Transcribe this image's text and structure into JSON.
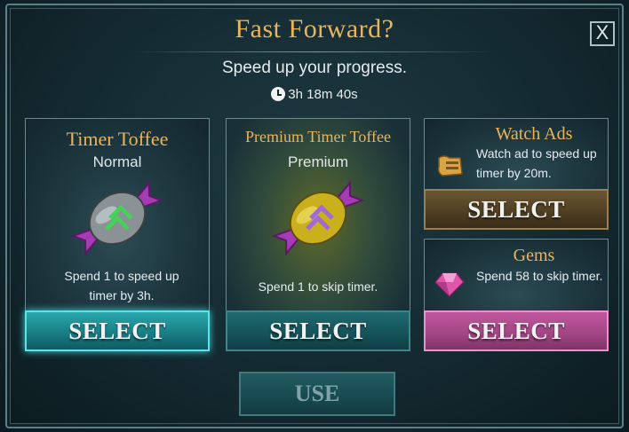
{
  "dialog": {
    "title": "Fast Forward?",
    "subtitle": "Speed up your progress.",
    "timer_text": "3h 18m 40s",
    "close_label": "X"
  },
  "options": {
    "timer_toffee": {
      "title": "Timer Toffee",
      "subtitle": "Normal",
      "description": "Spend 1 to speed up timer by 3h.",
      "button": "SELECT"
    },
    "premium_toffee": {
      "title": "Premium Timer Toffee",
      "subtitle": "Premium",
      "description": "Spend 1 to skip timer.",
      "button": "SELECT"
    },
    "watch_ads": {
      "title": "Watch Ads",
      "description": "Watch ad to speed up timer by 20m.",
      "button": "SELECT"
    },
    "gems": {
      "title": "Gems",
      "description": "Spend 58 to skip timer.",
      "button": "SELECT"
    }
  },
  "footer": {
    "use_label": "USE"
  },
  "colors": {
    "accent_gold": "#e8b45d",
    "selected_teal": "#5fe2e6",
    "gems_pink": "#c0579e",
    "ads_brown": "#6a5530"
  },
  "icons": [
    "close-icon",
    "clock-icon",
    "timer-toffee-candy-icon",
    "premium-toffee-candy-icon",
    "film-scroll-icon",
    "gem-icon"
  ]
}
